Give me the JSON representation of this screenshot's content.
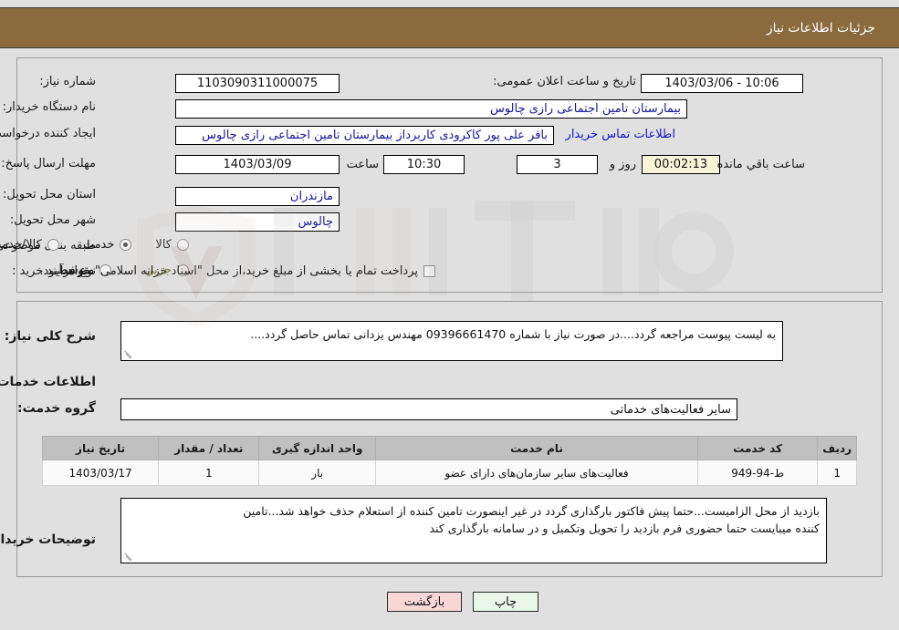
{
  "header": {
    "title": "جزئیات اطلاعات نیاز"
  },
  "form": {
    "need_number_label": "شماره نیاز:",
    "need_number_value": "1103090311000075",
    "announce_label": "تاریخ و ساعت اعلان عمومی:",
    "announce_value": "1403/03/06 - 10:06",
    "buyer_org_label": "نام دستگاه خریدار:",
    "buyer_org_value": "بیمارستان تامین اجتماعی رازی چالوس",
    "creator_label": "ایجاد کننده درخواست:",
    "creator_value": "باقر علی پور کاکرودی کاربرداز بیمارستان تامین اجتماعی رازی چالوس",
    "contact_link": "اطلاعات تماس خریدار",
    "deadline_label": "مهلت ارسال پاسخ: تا تاریخ:",
    "deadline_date": "1403/03/09",
    "hour_label": "ساعت",
    "deadline_time": "10:30",
    "days_value": "3",
    "days_label": "روز و",
    "countdown_value": "00:02:13",
    "remaining_label": "ساعت باقي مانده",
    "province_label": "استان محل تحویل:",
    "province_value": "مازندران",
    "city_label": "شهر محل تحویل:",
    "city_value": "چالوس",
    "category_label": "طبقه بندی موضوعی:",
    "category_options": [
      {
        "label": "کالا",
        "selected": false
      },
      {
        "label": "خدمت",
        "selected": true
      },
      {
        "label": "کالا/خدمت",
        "selected": false
      }
    ],
    "process_label": "نوع فرآیند خرید :",
    "process_options": [
      {
        "label": "جزیي",
        "selected": false
      },
      {
        "label": "متوسط",
        "selected": false
      }
    ],
    "treasury_checkbox_checked": false,
    "treasury_text": "پرداخت تمام یا بخشی از مبلغ خرید،از محل \"اسناد خزانه اسلامی\" خواهد بود."
  },
  "description": {
    "label": "شرح کلی نیاز:",
    "value": "به لیست پیوست مراجعه گردد....در صورت نیاز با شماره 09396661470 مهندس یزدانی تماس حاصل گردد...."
  },
  "services_section": {
    "heading": "اطلاعات خدمات مورد نیاز",
    "group_label": "گروه خدمت:",
    "group_value": "سایر فعالیت‌های خدماتی"
  },
  "table": {
    "columns": [
      "ردیف",
      "کد خدمت",
      "نام خدمت",
      "واحد اندازه گیری",
      "تعداد / مقدار",
      "تاریخ نیاز"
    ],
    "rows": [
      {
        "radif": "1",
        "code": "ط-94-949",
        "name": "فعالیت‌های سایر سازمان‌های دارای عضو",
        "unit": "بار",
        "qty": "1",
        "date": "1403/03/17"
      }
    ]
  },
  "buyer_notes": {
    "label": "توضیحات خریدار:",
    "line1": "بازدید از محل الزامیست...حتما پیش فاکتور بارگذاری گردد در غیر اینصورت تامین کننده از استعلام حذف خواهد شد...تامین",
    "line2": "کننده میبایست حتما حضوری فرم بازدید را تحویل وتکمیل و در سامانه بارگذاری کند"
  },
  "buttons": {
    "print": "چاپ",
    "back": "بازگشت"
  },
  "colors": {
    "header_bg": "#8b6b3e",
    "page_bg": "#e0e0e0",
    "link": "#1414d2",
    "field_text": "#15159a",
    "timer_bg": "#f7f4d8",
    "print_bg": "#e9f7e9",
    "back_bg": "#f8d7d7",
    "table_header_bg": "#c0c0c0"
  },
  "watermark": {
    "text": "AriaTender.net"
  }
}
